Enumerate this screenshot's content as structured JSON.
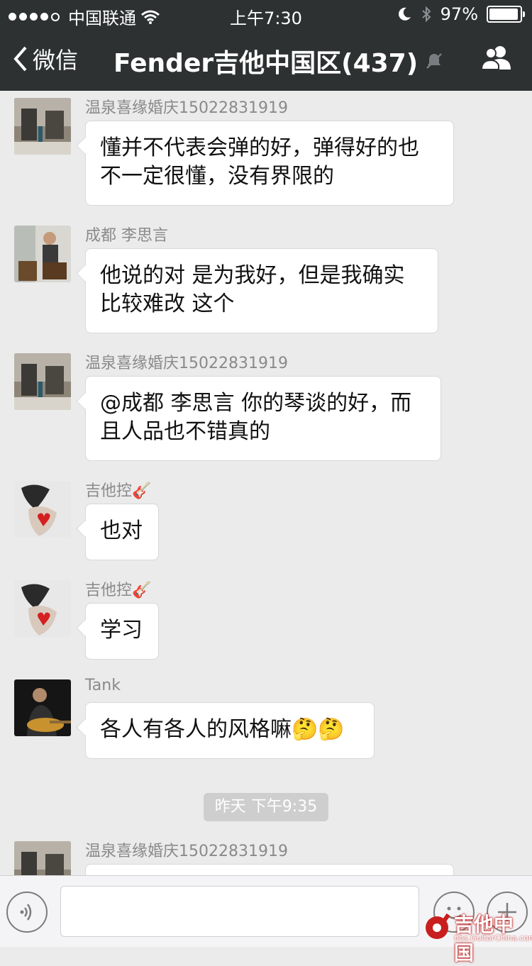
{
  "status_bar": {
    "carrier": "中国联通",
    "time": "上午7:30",
    "battery": "97%",
    "battery_level": 0.97,
    "signal_bars": 4
  },
  "nav": {
    "back_label": "微信",
    "title": "Fender吉他中国区(437)",
    "icons": [
      "chevron-left-icon",
      "mute-bell-icon",
      "group-members-icon"
    ]
  },
  "messages": [
    {
      "sender": "温泉喜缘婚庆15022831919",
      "lines": [
        "懂并不代表会弹的好，弹得好的也",
        "不一定很懂，没有界限的"
      ]
    },
    {
      "sender": "成都 李思言",
      "lines": [
        "他说的对 是为我好，但是我确实",
        "比较难改 这个"
      ]
    },
    {
      "sender": "温泉喜缘婚庆15022831919",
      "lines": [
        "@成都 李思言 你的琴谈的好，而",
        "且人品也不错真的"
      ]
    },
    {
      "sender": "吉他控🎸",
      "lines": [
        "也对"
      ]
    },
    {
      "sender": "吉他控🎸",
      "lines": [
        "学习"
      ]
    },
    {
      "sender": "Tank",
      "lines": [
        "各人有各人的风格嘛🤔🤔"
      ]
    }
  ],
  "timestamp": "昨天 下午9:35",
  "partial_message": {
    "sender": "温泉喜缘婚庆15022831919"
  },
  "input_bar": {
    "icons": [
      "voice-icon",
      "emoji-icon",
      "plus-icon"
    ]
  },
  "watermark": {
    "title": "吉他中国",
    "url": "bbs.GuitarChina.com"
  }
}
